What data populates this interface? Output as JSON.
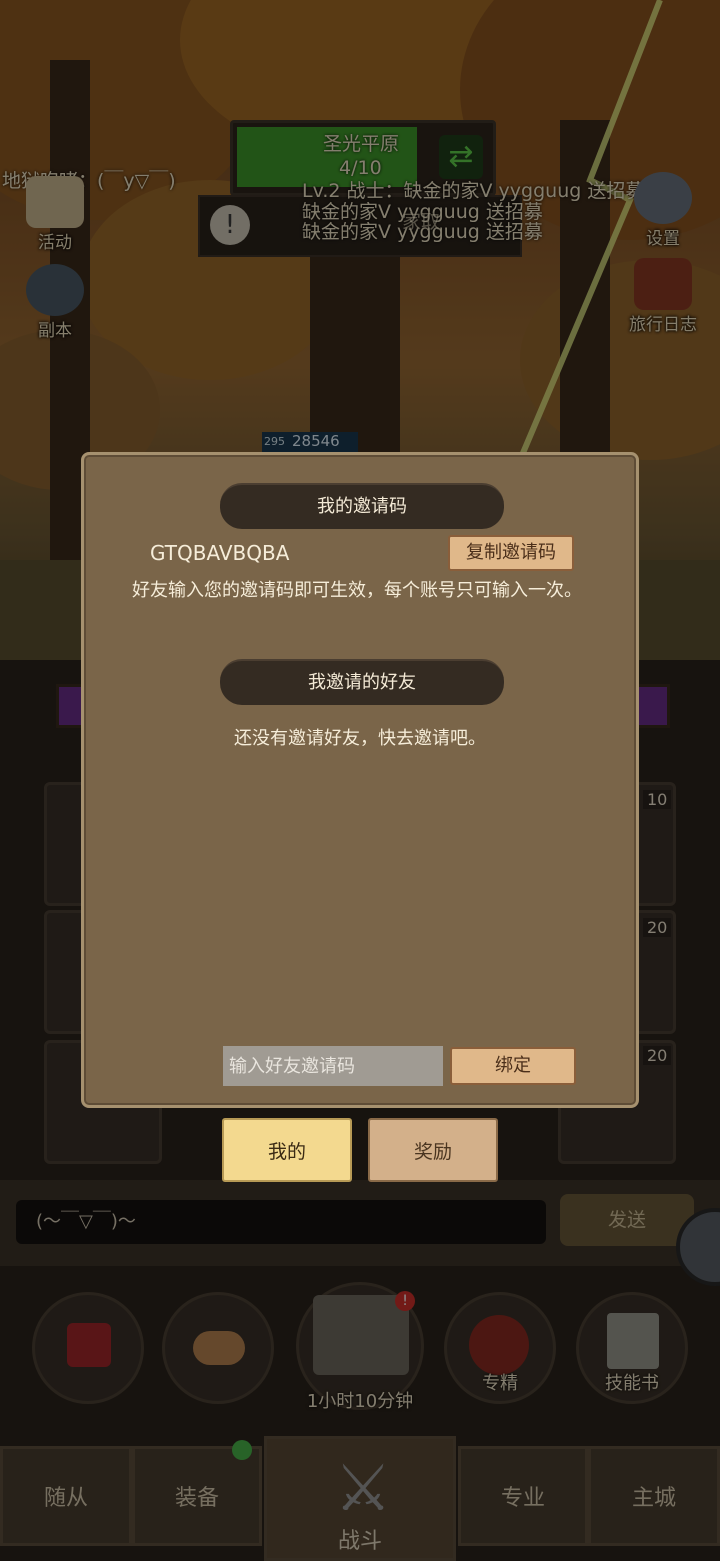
{
  "hud": {
    "zone_name": "圣光平原",
    "zone_progress": "4/10",
    "broadcast_prefix": "地狱咆哮：(￣y▽￣)",
    "messages": [
      "Lv.2 战士：缺金的家V  yygguug  送招募",
      "缺金的家V  yygguug  送招募",
      "缺金的家V  yygguug  送招募"
    ],
    "overlay_text": "家取",
    "hp_level": "295",
    "hp_value": "28546"
  },
  "side_buttons": {
    "left": [
      {
        "label": "活动",
        "icon": "scroll-icon"
      },
      {
        "label": "副本",
        "icon": "portal-icon"
      }
    ],
    "right": [
      {
        "label": "设置",
        "icon": "gear-icon"
      },
      {
        "label": "旅行日志",
        "icon": "journal-icon"
      }
    ]
  },
  "inventory": {
    "badges": [
      "10",
      "20",
      "20"
    ]
  },
  "modal": {
    "section1_title": "我的邀请码",
    "invite_code": "GTQBAVBQBA",
    "copy_button": "复制邀请码",
    "description": "好友输入您的邀请码即可生效，每个账号只可输入一次。",
    "section2_title": "我邀请的好友",
    "empty_text": "还没有邀请好友，快去邀请吧。",
    "input_placeholder": "输入好友邀请码",
    "bind_button": "绑定"
  },
  "modal_tabs": {
    "mine": "我的",
    "rewards": "奖励"
  },
  "chat": {
    "input_text": "(～￣▽￣)～",
    "send_button": "发送"
  },
  "action_buttons": [
    {
      "label": "",
      "icon": "potion-icon"
    },
    {
      "label": "",
      "icon": "bread-icon"
    },
    {
      "label": "1小时10分钟",
      "icon": "treasure-chest-icon"
    },
    {
      "label": "专精",
      "icon": "specialization-icon"
    },
    {
      "label": "技能书",
      "icon": "skill-book-icon"
    }
  ],
  "bottom_nav": {
    "followers": "随从",
    "equipment": "装备",
    "battle": "战斗",
    "profession": "专业",
    "main_city": "主城"
  },
  "colors": {
    "modal_bg": "#7a6549",
    "ribbon_bg": "#342b22",
    "plank": "#e0b88a",
    "active_tab": "#f3d98f"
  }
}
